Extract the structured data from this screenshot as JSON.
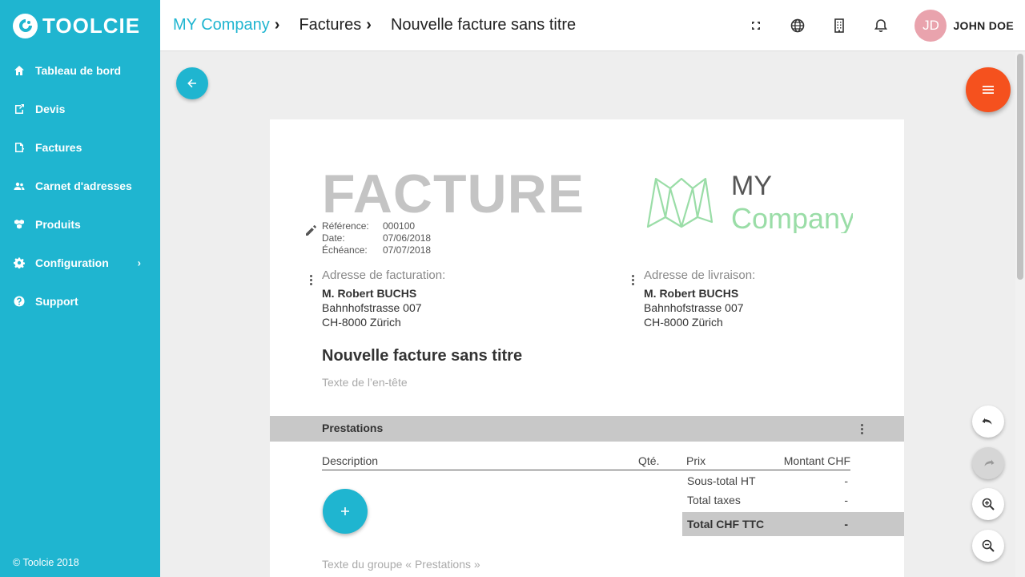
{
  "brand": {
    "name": "TOOLCIE"
  },
  "sidebar": {
    "items": [
      {
        "label": "Tableau de bord",
        "icon": "home-icon"
      },
      {
        "label": "Devis",
        "icon": "quote-icon"
      },
      {
        "label": "Factures",
        "icon": "invoice-icon"
      },
      {
        "label": "Carnet d'adresses",
        "icon": "contacts-icon"
      },
      {
        "label": "Produits",
        "icon": "products-icon"
      },
      {
        "label": "Configuration",
        "icon": "gear-icon"
      },
      {
        "label": "Support",
        "icon": "help-icon"
      }
    ],
    "copyright": "© Toolcie 2018"
  },
  "breadcrumb": {
    "company": "MY Company",
    "section": "Factures",
    "current": "Nouvelle facture sans titre"
  },
  "user": {
    "initials": "JD",
    "name": "JOHN DOE"
  },
  "document": {
    "title": "FACTURE",
    "meta": {
      "ref_label": "Référence:",
      "ref_value": "000100",
      "date_label": "Date:",
      "date_value": "07/06/2018",
      "due_label": "Échéance:",
      "due_value": "07/07/2018"
    },
    "logo": {
      "line1": "MY",
      "line2": "Company"
    },
    "billing": {
      "label": "Adresse de facturation:",
      "name": "M. Robert BUCHS",
      "street": "Bahnhofstrasse 007",
      "city": "CH-8000 Zürich"
    },
    "shipping": {
      "label": "Adresse de livraison:",
      "name": "M. Robert BUCHS",
      "street": "Bahnhofstrasse 007",
      "city": "CH-8000 Zürich"
    },
    "invoice_title": "Nouvelle facture sans titre",
    "header_placeholder": "Texte de l’en-tête",
    "section": "Prestations",
    "columns": {
      "description": "Description",
      "qty": "Qté.",
      "price": "Prix",
      "amount": "Montant CHF"
    },
    "totals": {
      "subtotal_label": "Sous-total HT",
      "subtotal_value": "-",
      "taxes_label": "Total taxes",
      "taxes_value": "-",
      "total_label": "Total CHF TTC",
      "total_value": "-"
    },
    "group_placeholder": "Texte du groupe « Prestations »"
  },
  "colors": {
    "accent": "#1fb5d0",
    "fab": "#f5511e",
    "logo_green": "#9adda7"
  }
}
